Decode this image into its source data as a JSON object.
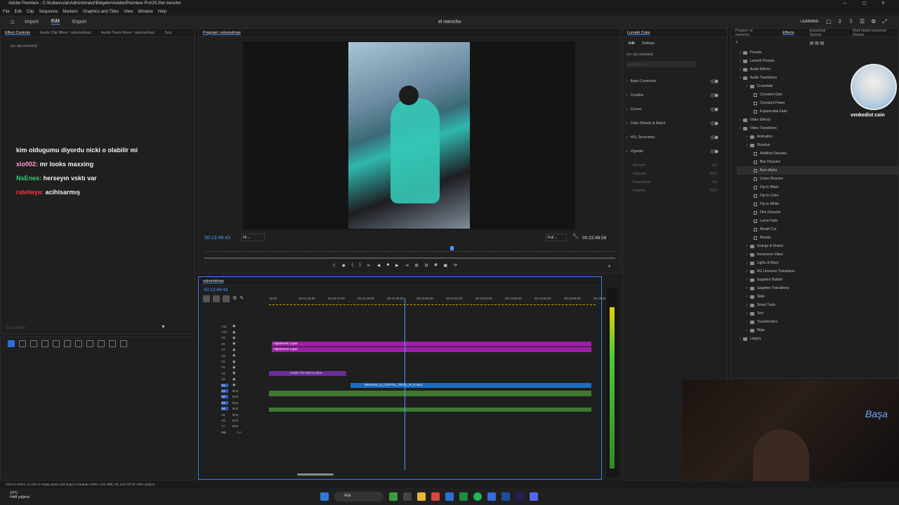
{
  "window": {
    "title": "Adobe Premiere - C:\\Kullanıcılar\\Administrator\\Belgeler\\Adobe\\Premiere Pro\\25.0\\el mencho"
  },
  "menu": [
    "File",
    "Edit",
    "Clip",
    "Sequence",
    "Markers",
    "Graphics and Titles",
    "View",
    "Window",
    "Help"
  ],
  "workspace": {
    "tabs": [
      "Import",
      "Edit",
      "Export"
    ],
    "active": "Edit",
    "project_title": "el mencho",
    "learning": "LEARNING"
  },
  "left_panel": {
    "tabs": [
      "Effect Controls",
      "Audio Clip Mixer: nolumolmaz",
      "Audio Track Mixer: nolumolmaz",
      "Sou"
    ],
    "no_clip": "(no clip selected)",
    "timecode": "00:13:48:43",
    "chat": [
      {
        "user": "",
        "msg": "kim oldugumu diyordu nicki o olabilir mi",
        "color": "#f1f1f1"
      },
      {
        "user": "xio002:",
        "msg": "mr looks maxxing",
        "color": "#ff9bd2"
      },
      {
        "user": "NsEnes:",
        "msg": "herseyın vsktı var",
        "color": "#33d17a"
      },
      {
        "user": "ratelwya:",
        "msg": "acihisarmış",
        "color": "#ff3040"
      }
    ]
  },
  "program": {
    "title": "Program: nolumolmaz",
    "timecode": "00:13:49:43",
    "fit": "Fit",
    "quality": "Full",
    "duration": "00:22:48:59"
  },
  "timeline": {
    "title": "nolumolmaz",
    "timecode": "00:13:49:43",
    "ruler": [
      "15:00",
      "00:13:46:00",
      "00:13:47:00",
      "00:13:48:00",
      "00:13:49:00",
      "00:13:50:00",
      "00:13:51:00",
      "00:13:52:00",
      "00:13:53:00",
      "00:13:54:00",
      "00:13:55:00",
      "00:13:56"
    ],
    "video_tracks": [
      "V11",
      "V10",
      "V9",
      "V8",
      "V7",
      "V6",
      "V5",
      "V4",
      "V3",
      "V2",
      "V1"
    ],
    "audio_tracks": [
      "A1",
      "A2",
      "A3",
      "A4",
      "A5",
      "A6",
      "A7"
    ],
    "mix": "Mix",
    "mix_value": "0,0",
    "clips": {
      "adj1": "Adjustment Layer",
      "adj2": "Adjustment Layer",
      "narco": "Inside The Narco Lifes...",
      "welcome": "Welcome_to_CARTEL_TikTok_Pt_6.mp4",
      "fx": "fx"
    }
  },
  "lumetri": {
    "title": "Lumetri Color",
    "tabs": [
      "Edit",
      "Settings"
    ],
    "no_clip": "(no clip selected)",
    "dropdown": "Lumetri Color",
    "sections": [
      "Basic Correction",
      "Creative",
      "Curves",
      "Color Wheels & Match",
      "HSL Secondary",
      "Vignette"
    ],
    "vignette_params": [
      {
        "name": "Amount",
        "value": "0,0"
      },
      {
        "name": "Midpoint",
        "value": "50,0"
      },
      {
        "name": "Roundness",
        "value": "0,0"
      },
      {
        "name": "Feather",
        "value": "50,0"
      }
    ]
  },
  "effects_panel": {
    "tabs": [
      "Project: el mencho",
      "Effects",
      "Essential Sound",
      "Red Giant Universe Dashb"
    ],
    "active": "Effects",
    "tree": [
      {
        "label": "Presets",
        "level": 0,
        "type": "folder"
      },
      {
        "label": "Lumetri Presets",
        "level": 0,
        "type": "folder"
      },
      {
        "label": "Audio Effects",
        "level": 0,
        "type": "folder"
      },
      {
        "label": "Audio Transitions",
        "level": 0,
        "type": "folder"
      },
      {
        "label": "Crossfade",
        "level": 1,
        "type": "folder"
      },
      {
        "label": "Constant Gain",
        "level": 2,
        "type": "item"
      },
      {
        "label": "Constant Power",
        "level": 2,
        "type": "item"
      },
      {
        "label": "Exponential Fade",
        "level": 2,
        "type": "item"
      },
      {
        "label": "Video Effects",
        "level": 0,
        "type": "folder"
      },
      {
        "label": "Video Transitions",
        "level": 0,
        "type": "folder"
      },
      {
        "label": "Animation",
        "level": 1,
        "type": "folder"
      },
      {
        "label": "Dissolve",
        "level": 1,
        "type": "folder"
      },
      {
        "label": "Additive Dissolve",
        "level": 2,
        "type": "item"
      },
      {
        "label": "Blur Dissolve",
        "level": 2,
        "type": "item"
      },
      {
        "label": "Burn Alpha",
        "level": 2,
        "type": "item"
      },
      {
        "label": "Cross Dissolve",
        "level": 2,
        "type": "item"
      },
      {
        "label": "Dip to Black",
        "level": 2,
        "type": "item"
      },
      {
        "label": "Dip to Color",
        "level": 2,
        "type": "item"
      },
      {
        "label": "Dip to White",
        "level": 2,
        "type": "item"
      },
      {
        "label": "Film Dissolve",
        "level": 2,
        "type": "item"
      },
      {
        "label": "Luma Fade",
        "level": 2,
        "type": "item"
      },
      {
        "label": "Morph Cut",
        "level": 2,
        "type": "item"
      },
      {
        "label": "Mosaic",
        "level": 2,
        "type": "item"
      },
      {
        "label": "Grange & Distort",
        "level": 1,
        "type": "folder"
      },
      {
        "label": "Immersive Video",
        "level": 1,
        "type": "folder"
      },
      {
        "label": "Lights & Blurs",
        "level": 1,
        "type": "folder"
      },
      {
        "label": "RG Universe Transitions",
        "level": 1,
        "type": "folder"
      },
      {
        "label": "Sapphire Builder",
        "level": 1,
        "type": "folder"
      },
      {
        "label": "Sapphire Transitions",
        "level": 1,
        "type": "folder"
      },
      {
        "label": "Slide",
        "level": 1,
        "type": "folder"
      },
      {
        "label": "Smart Tools",
        "level": 1,
        "type": "folder"
      },
      {
        "label": "Text",
        "level": 1,
        "type": "folder"
      },
      {
        "label": "Transformers",
        "level": 1,
        "type": "folder"
      },
      {
        "label": "Wipe",
        "level": 1,
        "type": "folder"
      },
      {
        "label": "Legacy",
        "level": 0,
        "type": "folder"
      }
    ],
    "overlay_text": "venkedist coin"
  },
  "statusbar": {
    "hint": "Click to select, or click in empty space and drag to marquee select. Use Shift, Alt, and Ctrl for other options."
  },
  "taskbar": {
    "temp": "14°C",
    "weather": "Hafif yağmur",
    "search": "Ara"
  },
  "webcam": {
    "neon": "Başa"
  }
}
